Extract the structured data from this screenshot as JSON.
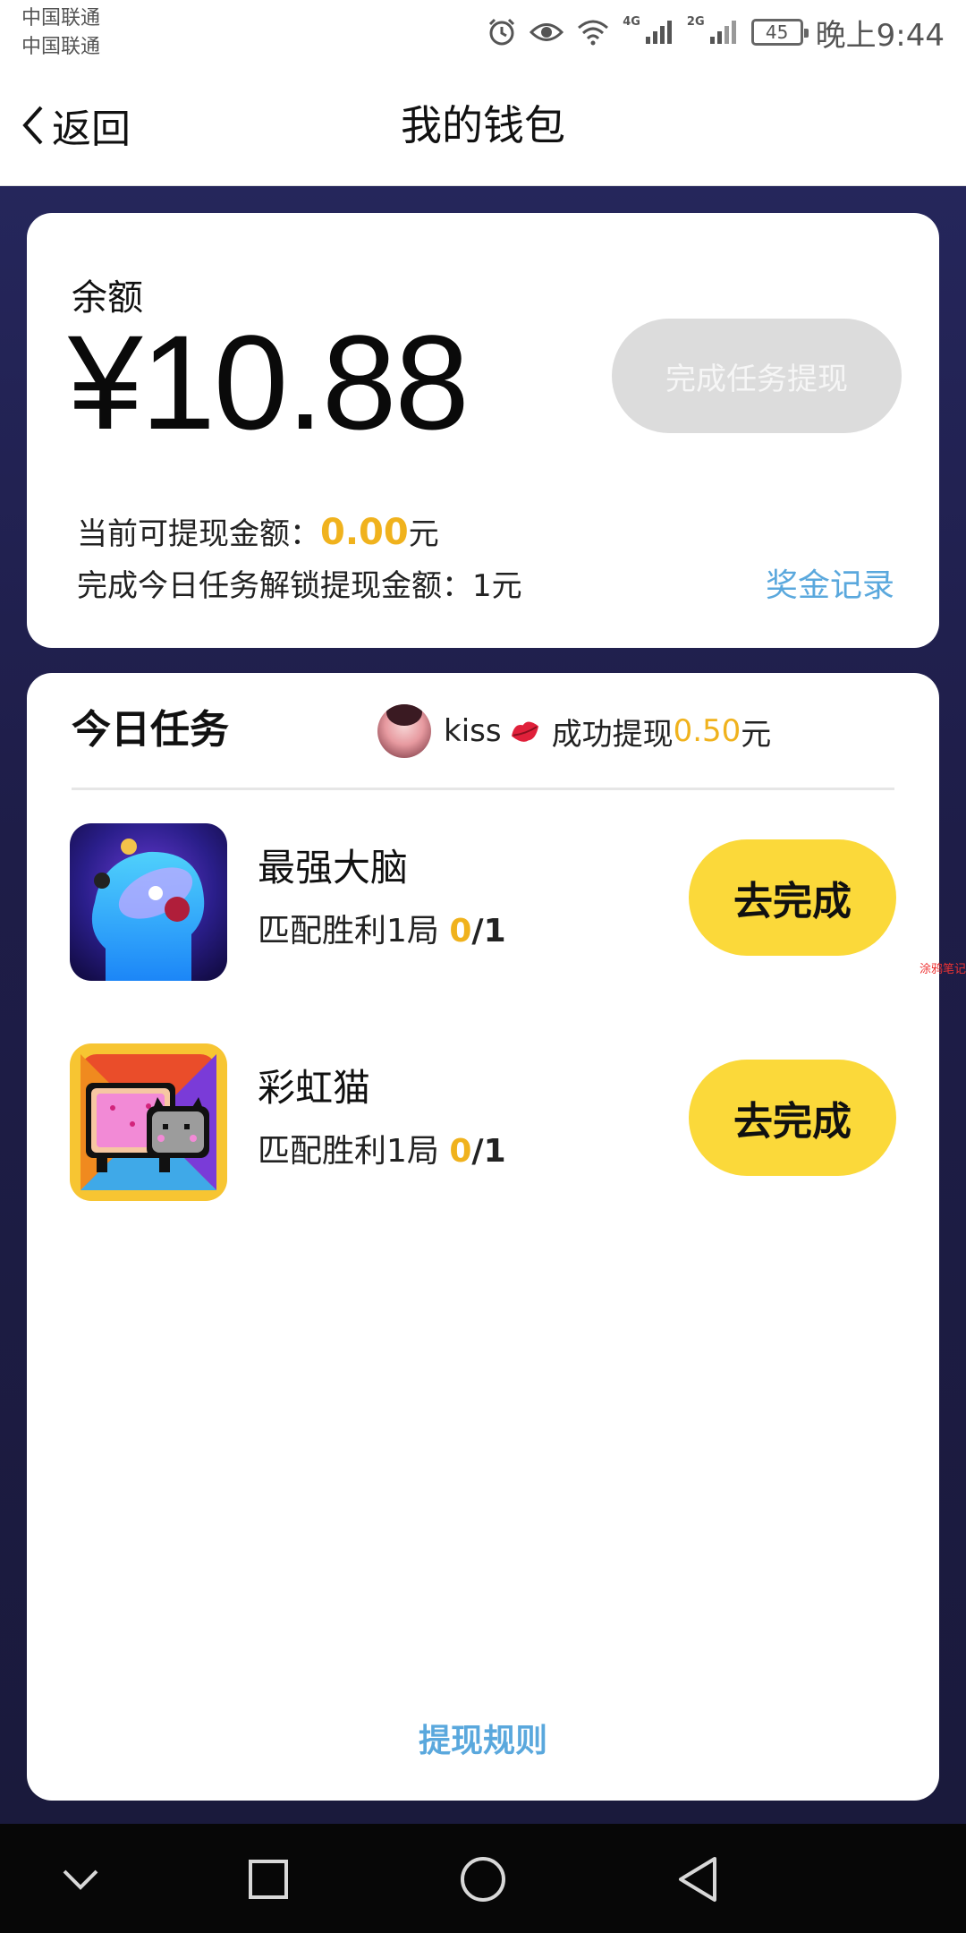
{
  "status_bar": {
    "carrier_1": "中国联通",
    "carrier_2": "中国联通",
    "net_4g": "4G",
    "net_2g": "2G",
    "battery": "45",
    "time": "晚上9:44"
  },
  "nav": {
    "back_label": "返回",
    "title": "我的钱包"
  },
  "wallet": {
    "balance_label": "余额",
    "balance_value": "¥10.88",
    "withdraw_button": "完成任务提现",
    "available_prefix": "当前可提现金额：",
    "available_amount": "0.00",
    "available_suffix": "元",
    "unlock_text": "完成今日任务解锁提现金额：1元",
    "bonus_link": "奖金记录"
  },
  "tasks": {
    "header": "今日任务",
    "ticker": {
      "user": "kiss",
      "text": "成功提现",
      "amount": "0.50",
      "unit": "元"
    },
    "items": [
      {
        "name": "最强大脑",
        "requirement": "匹配胜利1局",
        "done": "0",
        "total": "/1",
        "button": "去完成",
        "icon": "brain-game-icon"
      },
      {
        "name": "彩虹猫",
        "requirement": "匹配胜利1局",
        "done": "0",
        "total": "/1",
        "button": "去完成",
        "icon": "nyan-cat-game-icon"
      }
    ],
    "rules_link": "提现规则"
  },
  "edge_tag": "涂鸦笔记",
  "system_nav": {
    "icons": [
      "chevron-down-icon",
      "recent-apps-icon",
      "home-icon",
      "back-triangle-icon"
    ]
  },
  "colors": {
    "accent_yellow": "#fbd93a",
    "amount_orange": "#f0b21d",
    "link_blue": "#5aa8dd",
    "background_navy": "#1e1d48"
  }
}
